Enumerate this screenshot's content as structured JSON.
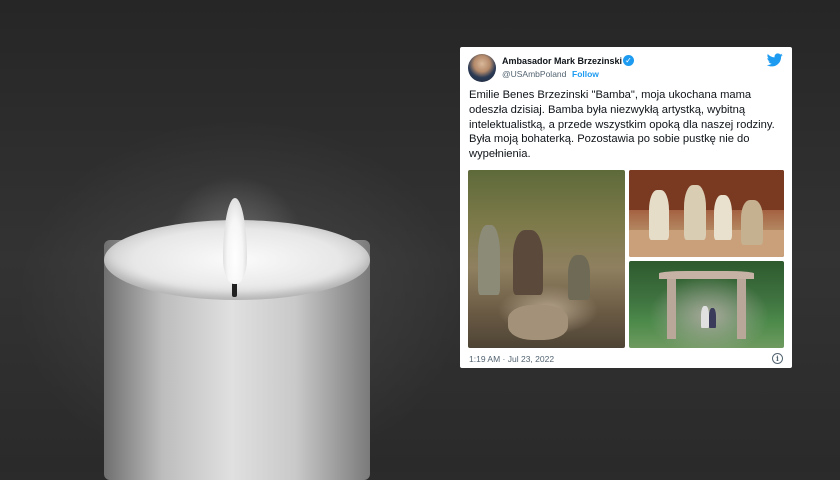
{
  "tweet": {
    "author_name": "Ambasador Mark Brzezinski",
    "handle": "@USAmbPoland",
    "separator": "·",
    "follow_label": "Follow",
    "text": "Emilie Benes Brzezinski \"Bamba\", moja ukochana mama odeszła dzisiaj. Bamba była niezwykłą artystką, wybitną intelektualistką, a przede wszystkim opoką dla naszej rodziny. Była moją bohaterką. Pozostawia po sobie pustkę nie do wypełnienia.",
    "timestamp": "1:19 AM · Jul 23, 2022",
    "verified_icon": "verified-badge-icon",
    "brand_icon": "twitter-bird-icon",
    "info_icon": "info-icon",
    "photos": [
      {
        "name": "family-photo-rocks"
      },
      {
        "name": "family-photo-porch"
      },
      {
        "name": "family-photo-gate"
      }
    ]
  },
  "colors": {
    "twitter_blue": "#1d9bf0",
    "text_primary": "#0f1419",
    "text_secondary": "#536471",
    "background": "#2b2b2b"
  }
}
